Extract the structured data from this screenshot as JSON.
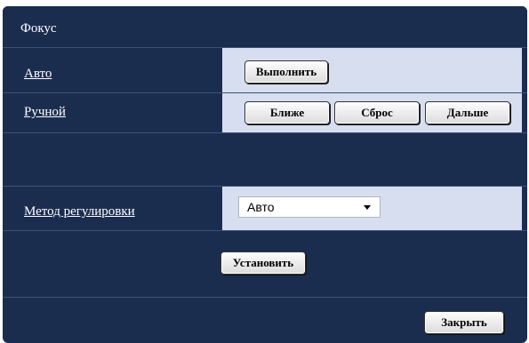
{
  "panel": {
    "title": "Фокус"
  },
  "auto_row": {
    "label": "Авто",
    "execute_button": "Выполнить"
  },
  "manual_row": {
    "label": "Ручной",
    "near_button": "Ближе",
    "reset_button": "Сброс",
    "far_button": "Дальше"
  },
  "method_row": {
    "label": "Метод регулировки",
    "selected": "Авто"
  },
  "actions": {
    "set_button": "Установить",
    "close_button": "Закрыть"
  },
  "colors": {
    "panel_bg": "#1b2d4f",
    "field_bg": "#d6def0",
    "separator": "#3b5278"
  }
}
